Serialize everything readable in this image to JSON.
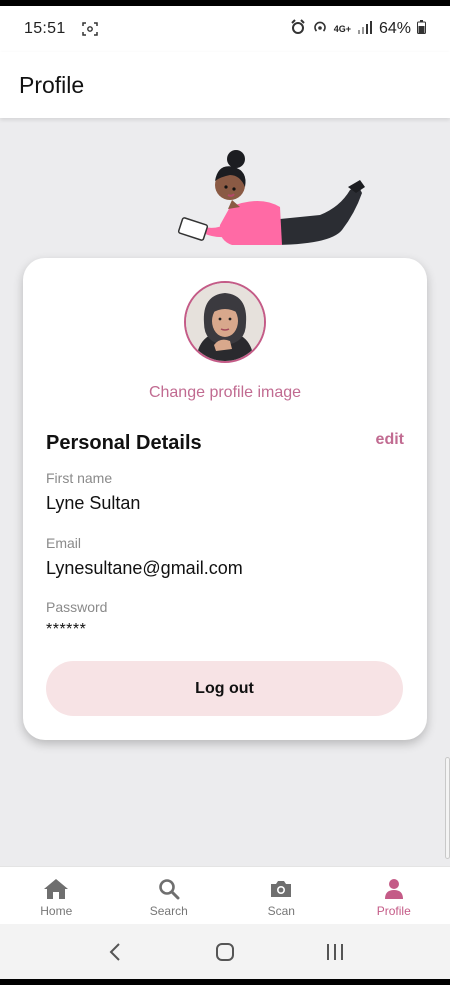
{
  "status_bar": {
    "time": "15:51",
    "network": "4G+",
    "battery": "64%"
  },
  "header": {
    "title": "Profile"
  },
  "profile": {
    "change_image_label": "Change profile image",
    "section_title": "Personal Details",
    "edit_label": "edit",
    "fields": [
      {
        "label": "First name",
        "value": "Lyne Sultan"
      },
      {
        "label": "Email",
        "value": "Lynesultane@gmail.com"
      },
      {
        "label": "Password",
        "value": "******"
      }
    ],
    "logout_label": "Log out"
  },
  "bottom_nav": {
    "items": [
      {
        "label": "Home",
        "icon": "home-icon"
      },
      {
        "label": "Search",
        "icon": "search-icon"
      },
      {
        "label": "Scan",
        "icon": "camera-icon"
      },
      {
        "label": "Profile",
        "icon": "person-icon",
        "active": true
      }
    ]
  },
  "colors": {
    "accent": "#c45b87",
    "link": "#c16b91",
    "logout_bg": "#f7e3e5",
    "page_bg": "#ececee"
  }
}
